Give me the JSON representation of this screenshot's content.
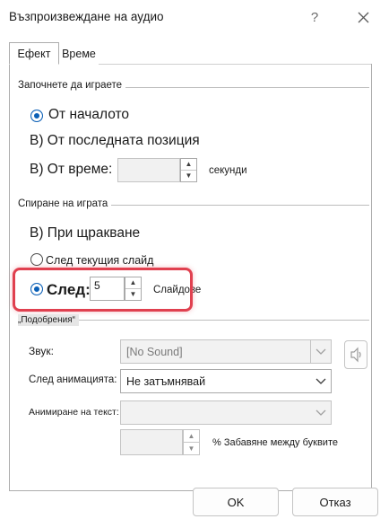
{
  "window": {
    "title": "Възпроизвеждане на аудио",
    "help_icon": "question-icon",
    "close_icon": "close-icon"
  },
  "tabs": [
    {
      "label": "Ефект",
      "active": true
    },
    {
      "label": "Време",
      "active": false
    }
  ],
  "start_group": {
    "label": "Започнете да играете",
    "options": [
      {
        "label": "От началото",
        "selected": true
      },
      {
        "label": "В) От последната позиция",
        "selected": false
      },
      {
        "label": "В) От време:",
        "selected": false
      }
    ],
    "time_value": "",
    "time_unit": "секунди"
  },
  "stop_group": {
    "label": "Спиране на играта",
    "options": [
      {
        "label": "В) При щракване",
        "selected": false
      },
      {
        "label": "След текущия слайд",
        "selected": false
      },
      {
        "label": "След:",
        "selected": true
      }
    ],
    "after_value": "5",
    "after_unit": "Слайдове"
  },
  "enhancements_group": {
    "label": "„Подобрения“",
    "sound_label": "Звук:",
    "sound_value": "[No Sound]",
    "after_animation_label": "След анимацията:",
    "after_animation_value": "Не затъмнявай",
    "animate_text_label": "Анимиране на текст:",
    "animate_text_value": "",
    "delay_value": "",
    "delay_unit": "% Забавяне между буквите",
    "speaker_icon": "speaker-icon"
  },
  "footer": {
    "ok_label": "OK",
    "cancel_label": "Отказ"
  },
  "colors": {
    "accent": "#0a5fb6",
    "highlight": "#e0404f"
  }
}
